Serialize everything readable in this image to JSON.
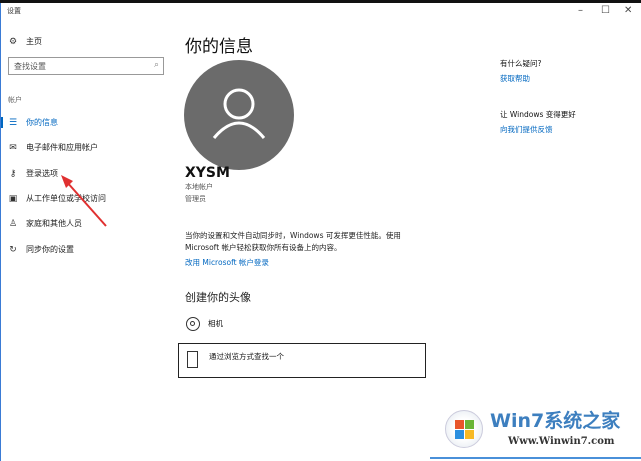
{
  "window": {
    "title": "设置",
    "minimize": "–",
    "maximize": "☐",
    "close": "✕"
  },
  "sidebar": {
    "home": "主页",
    "search_placeholder": "查找设置",
    "section": "帐户",
    "items": [
      {
        "label": "你的信息",
        "icon": "person-list-icon",
        "active": true
      },
      {
        "label": "电子邮件和应用帐户",
        "icon": "mail-icon"
      },
      {
        "label": "登录选项",
        "icon": "key-icon"
      },
      {
        "label": "从工作单位或学校访问",
        "icon": "briefcase-icon"
      },
      {
        "label": "家庭和其他人员",
        "icon": "person-add-icon"
      },
      {
        "label": "同步你的设置",
        "icon": "sync-icon"
      }
    ]
  },
  "main": {
    "title": "你的信息",
    "username": "XYSM",
    "account_type": "本地帐户",
    "role": "管理员",
    "description": "当你的设置和文件自动同步时，Windows 可发挥更佳性能。使用 Microsoft 帐户轻松获取你所有设备上的内容。",
    "ms_link": "改用 Microsoft 帐户登录",
    "avatar_heading": "创建你的头像",
    "camera": "相机",
    "browse": "通过浏览方式查找一个"
  },
  "right": {
    "question": "有什么疑问?",
    "help_link": "获取帮助",
    "improve": "让 Windows 变得更好",
    "feedback_link": "向我们提供反馈"
  },
  "watermark": {
    "brand": "Win7系统之家",
    "url": "Www.Winwin7.com"
  },
  "colors": {
    "accent": "#0067c0",
    "arrow": "#e03030"
  }
}
